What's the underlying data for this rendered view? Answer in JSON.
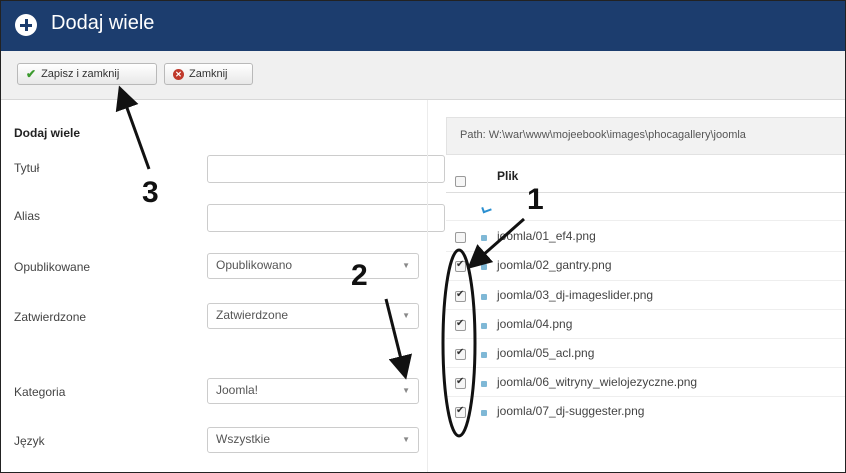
{
  "header": {
    "title": "Dodaj wiele"
  },
  "toolbar": {
    "save_label": "Zapisz i zamknij",
    "close_label": "Zamknij"
  },
  "form": {
    "heading": "Dodaj wiele",
    "title_label": "Tytuł",
    "title_value": "",
    "alias_label": "Alias",
    "alias_value": "",
    "published_label": "Opublikowane",
    "published_value": "Opublikowano",
    "approved_label": "Zatwierdzone",
    "approved_value": "Zatwierdzone",
    "category_label": "Kategoria",
    "category_value": "Joomla!",
    "language_label": "Język",
    "language_value": "Wszystkie"
  },
  "files": {
    "path": "Path: W:\\war\\www\\mojeebook\\images\\phocagallery\\joomla",
    "column_header": "Plik",
    "rows": [
      {
        "name": "joomla/01_ef4.png",
        "checked": false
      },
      {
        "name": "joomla/02_gantry.png",
        "checked": true
      },
      {
        "name": "joomla/03_dj-imageslider.png",
        "checked": true
      },
      {
        "name": "joomla/04.png",
        "checked": true
      },
      {
        "name": "joomla/05_acl.png",
        "checked": true
      },
      {
        "name": "joomla/06_witryny_wielojezyczne.png",
        "checked": true
      },
      {
        "name": "joomla/07_dj-suggester.png",
        "checked": true
      }
    ]
  },
  "annotations": {
    "num1": "1",
    "num2": "2",
    "num3": "3"
  },
  "colors": {
    "header_bg": "#1c3d6e",
    "header_text": "#ffffff",
    "save_icon": "#3c9a2e",
    "close_icon": "#c0392b"
  },
  "icons": {
    "header": "plus-circle-icon",
    "save": "check-icon",
    "close": "close-circle-icon",
    "file": "image-file-icon",
    "up": "folder-up-icon"
  }
}
